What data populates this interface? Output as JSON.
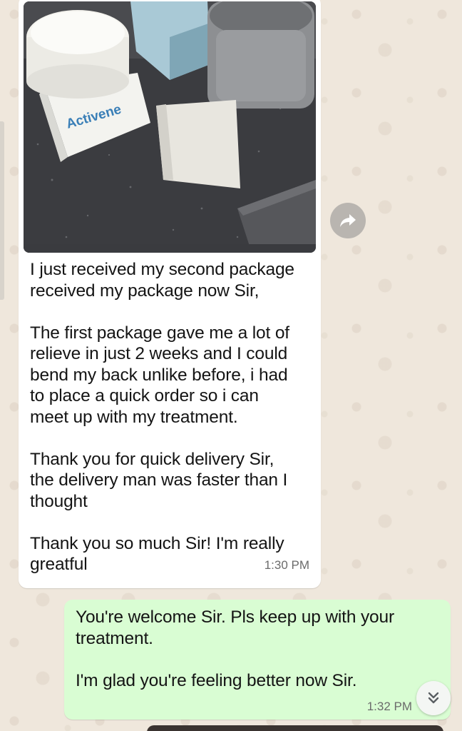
{
  "chat": {
    "incoming": {
      "photo_brand_text": "Activene",
      "text": "I just received my second package\nreceived my package now Sir,\n\nThe first package gave me a lot of\nrelieve in just 2 weeks and I could\nbend my back unlike before, i had\nto place a quick order so i can\nmeet up with my treatment.\n\nThank you for quick delivery Sir,\nthe delivery man was faster than I\nthought\n\nThank you so much Sir! I'm really\ngreatful",
      "time": "1:30 PM"
    },
    "outgoing": {
      "text": "You're welcome Sir. Pls keep up with your\ntreatment.\n\nI'm glad you're feeling better now Sir.",
      "time": "1:32 PM"
    },
    "icons": {
      "forward": "forward-arrow-icon",
      "scroll_down": "double-chevron-down-icon"
    },
    "colors": {
      "background": "#efe7dc",
      "incoming_bubble": "#ffffff",
      "outgoing_bubble": "#d9fdd3"
    }
  }
}
